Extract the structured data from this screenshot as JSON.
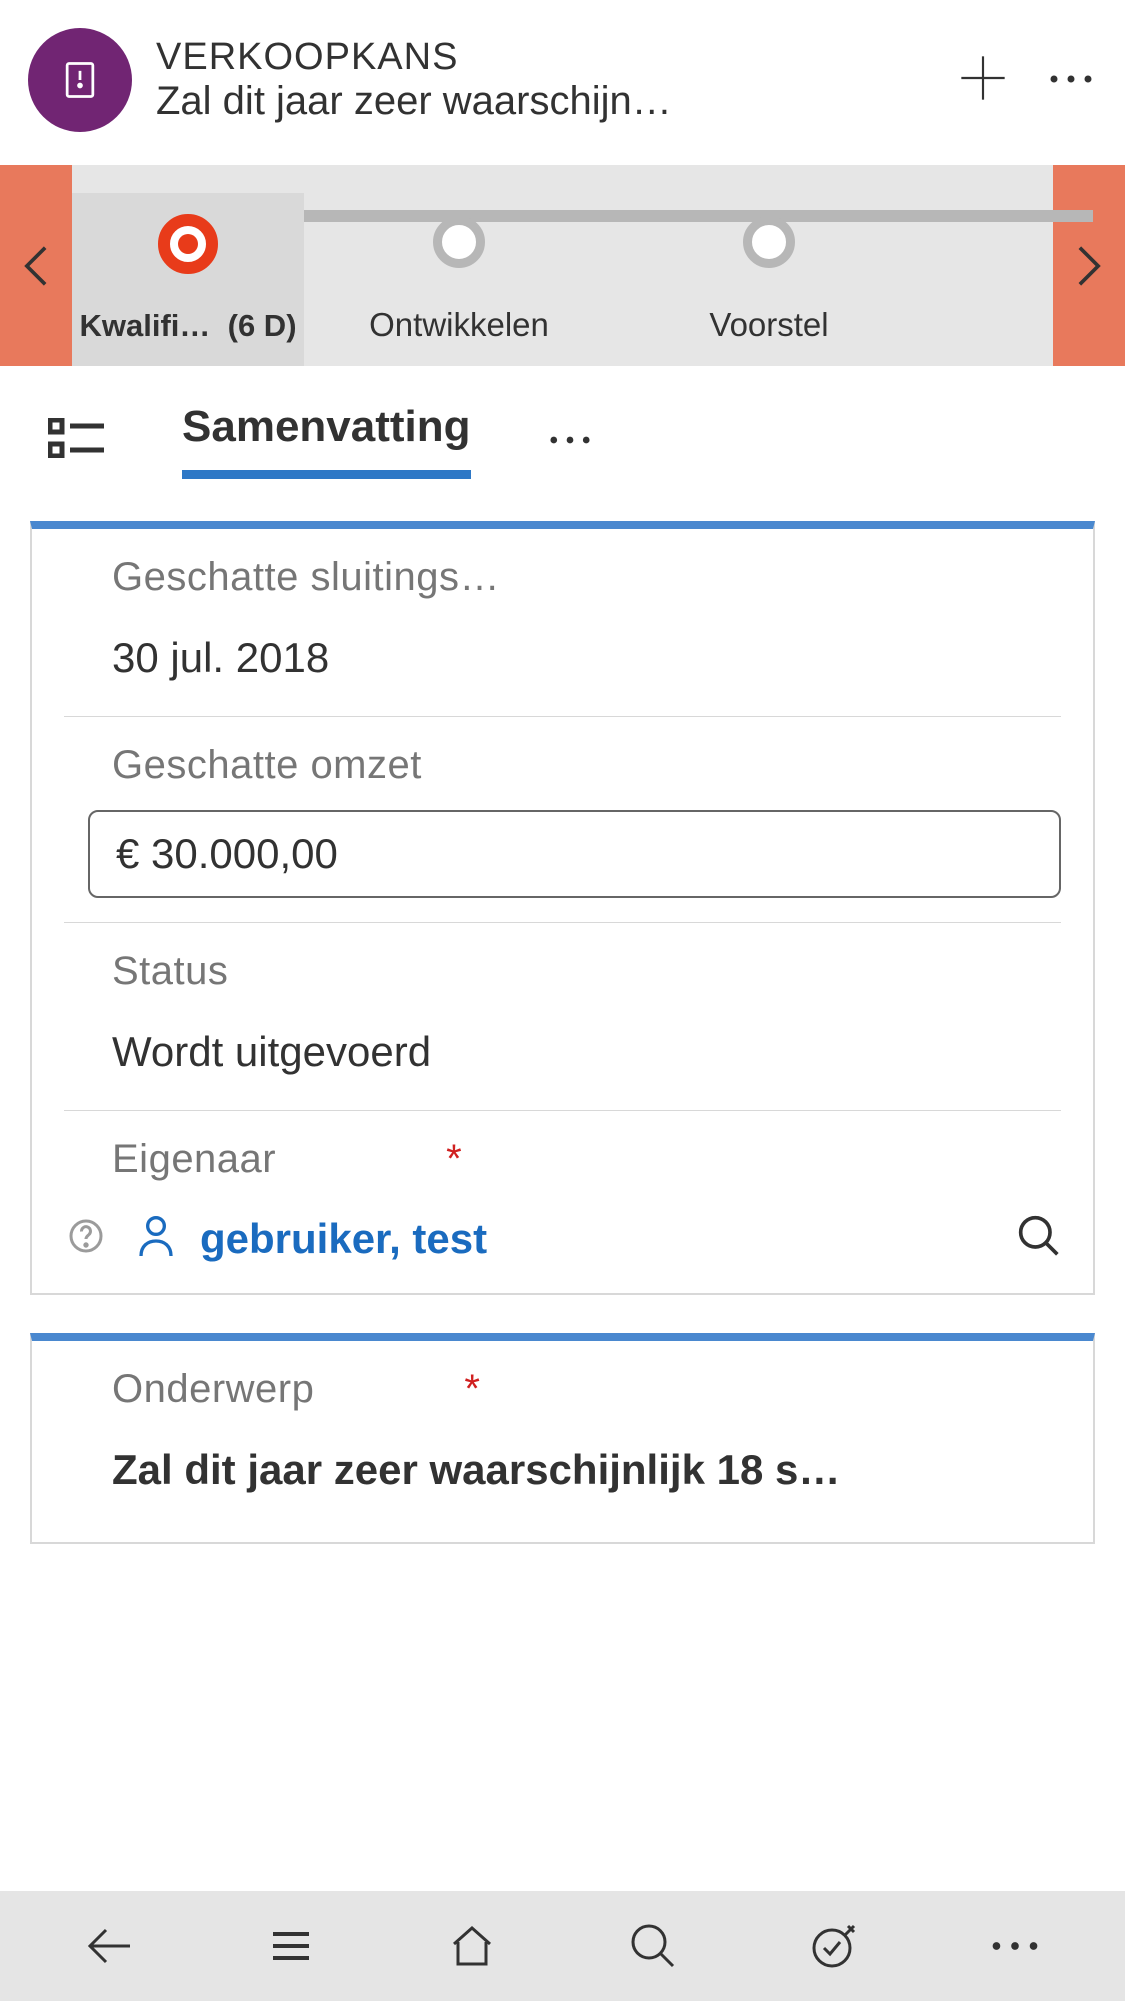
{
  "header": {
    "title": "VERKOOPKANS",
    "subtitle": "Zal dit jaar zeer waarschijn…"
  },
  "stages": {
    "s1_label": "Kwalifi…",
    "s1_duration": "(6 D)",
    "s2_label": "Ontwikkelen",
    "s3_label": "Voorstel"
  },
  "tab": {
    "active_label": "Samenvatting"
  },
  "fields": {
    "close_date_label": "Geschatte sluitings…",
    "close_date_value": "30 jul. 2018",
    "revenue_label": "Geschatte omzet",
    "revenue_value": "€ 30.000,00",
    "status_label": "Status",
    "status_value": "Wordt uitgevoerd",
    "owner_label": "Eigenaar",
    "owner_value": "gebruiker, test",
    "subject_label": "Onderwerp",
    "subject_value": "Zal dit jaar zeer waarschijnlijk 18 s…"
  }
}
